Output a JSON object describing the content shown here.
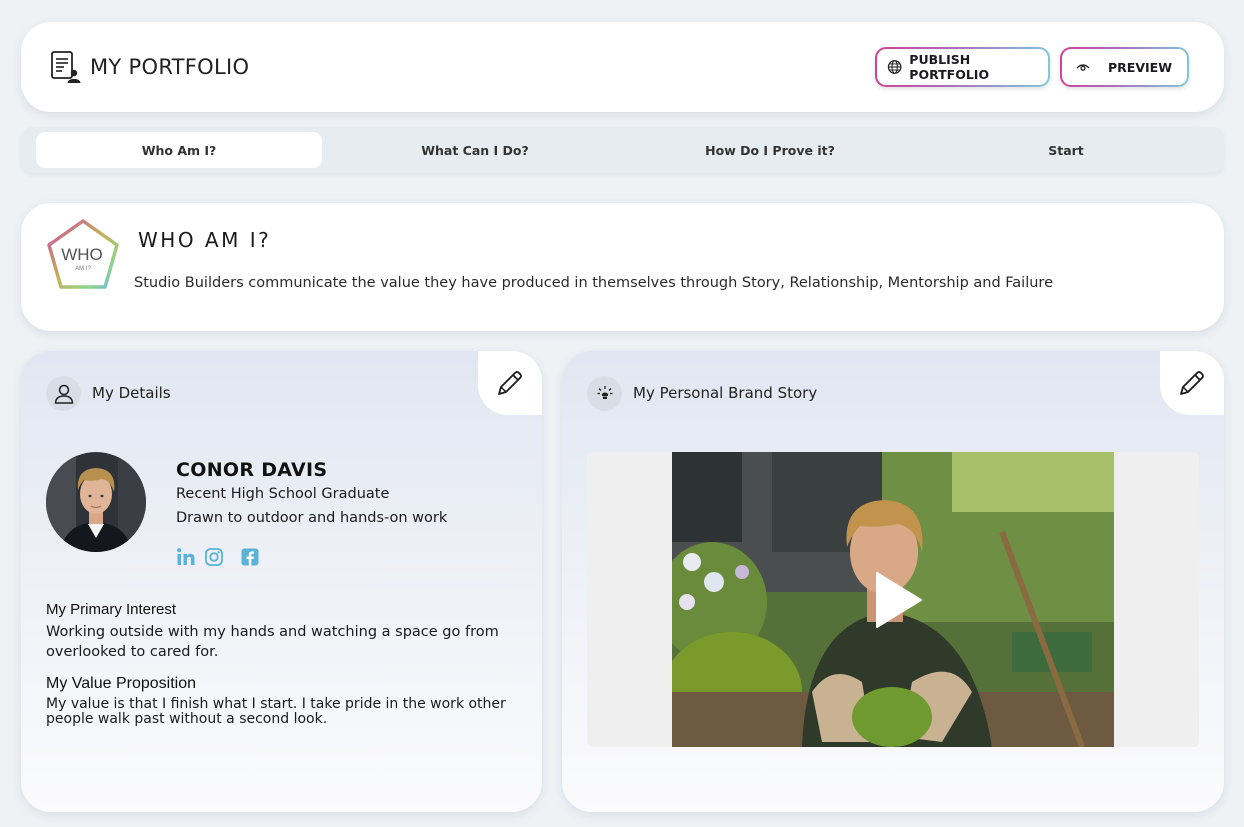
{
  "header": {
    "title": "MY PORTFOLIO",
    "publish_label": "PUBLISH PORTFOLIO",
    "preview_label": "PREVIEW"
  },
  "tabs": [
    {
      "label": "Who Am I?",
      "active": true
    },
    {
      "label": "What Can I Do?",
      "active": false
    },
    {
      "label": "How Do I Prove it?",
      "active": false
    },
    {
      "label": "Start",
      "active": false
    }
  ],
  "who": {
    "badge_text": "WHO",
    "badge_sub": "AM I?",
    "title": "WHO AM I?",
    "description": "Studio Builders communicate the value they have produced in themselves through Story, Relationship, Mentorship and Failure"
  },
  "details": {
    "heading": "My Details",
    "name": "CONOR DAVIS",
    "role": "Recent High School Graduate",
    "tagline": "Drawn to outdoor and hands-on work",
    "interest_label": "My Primary Interest",
    "interest_text": "Working outside with my hands and watching a space go from overlooked to cared for.",
    "value_label": "My Value Proposition",
    "value_text": "My value is that I finish what I start. I take pride in the work other people walk past without a second look."
  },
  "story": {
    "heading": "My Personal Brand Story"
  },
  "colors": {
    "accent_pink": "#d3418f",
    "accent_teal": "#7fcbd9",
    "social_blue": "#5bb3d6"
  }
}
